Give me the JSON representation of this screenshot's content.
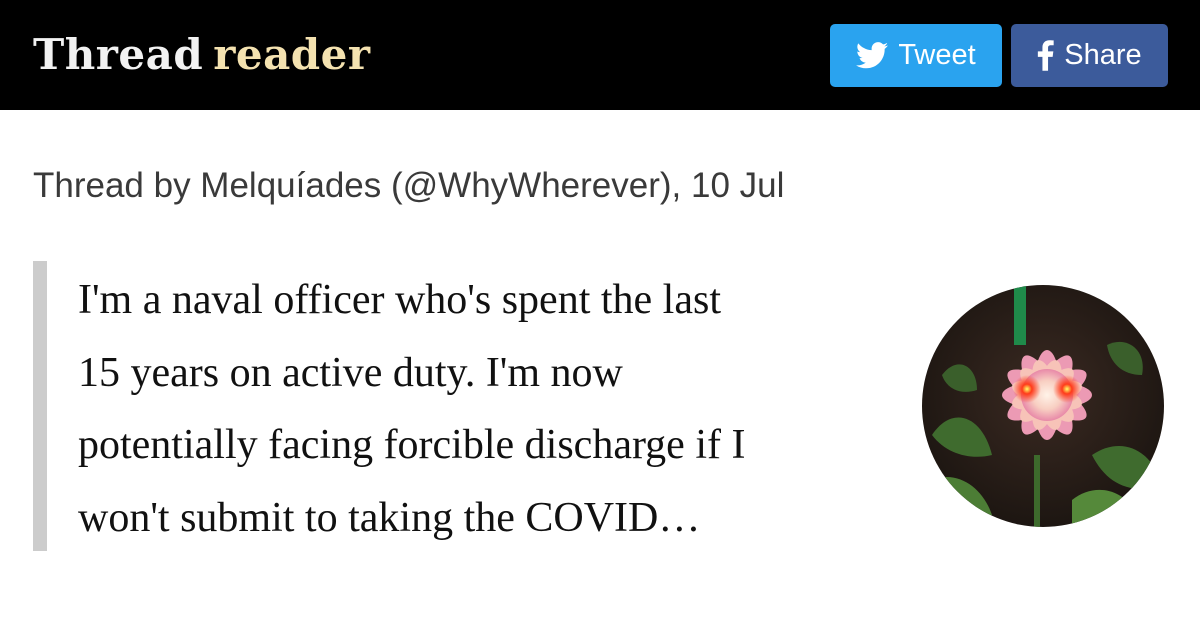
{
  "header": {
    "logo_word1": "Thread",
    "logo_word2": "reader",
    "tweet_button": "Tweet",
    "share_button": "Share",
    "tweet_icon": "twitter-bird-icon",
    "share_icon": "facebook-f-icon"
  },
  "thread": {
    "byline": "Thread by Melquíades (@WhyWherever), 10 Jul",
    "text_lines": [
      "I'm a naval officer who's spent the last",
      "15 years on active duty. I'm now",
      "potentially facing forcible discharge if I",
      "won't submit to taking the COVID…"
    ]
  },
  "colors": {
    "topbar": "#000000",
    "tweet_button": "#2aa3ef",
    "share_button": "#3c5b9b",
    "logo_accent": "#f4e2b0",
    "quote_bar": "#cccccc"
  }
}
